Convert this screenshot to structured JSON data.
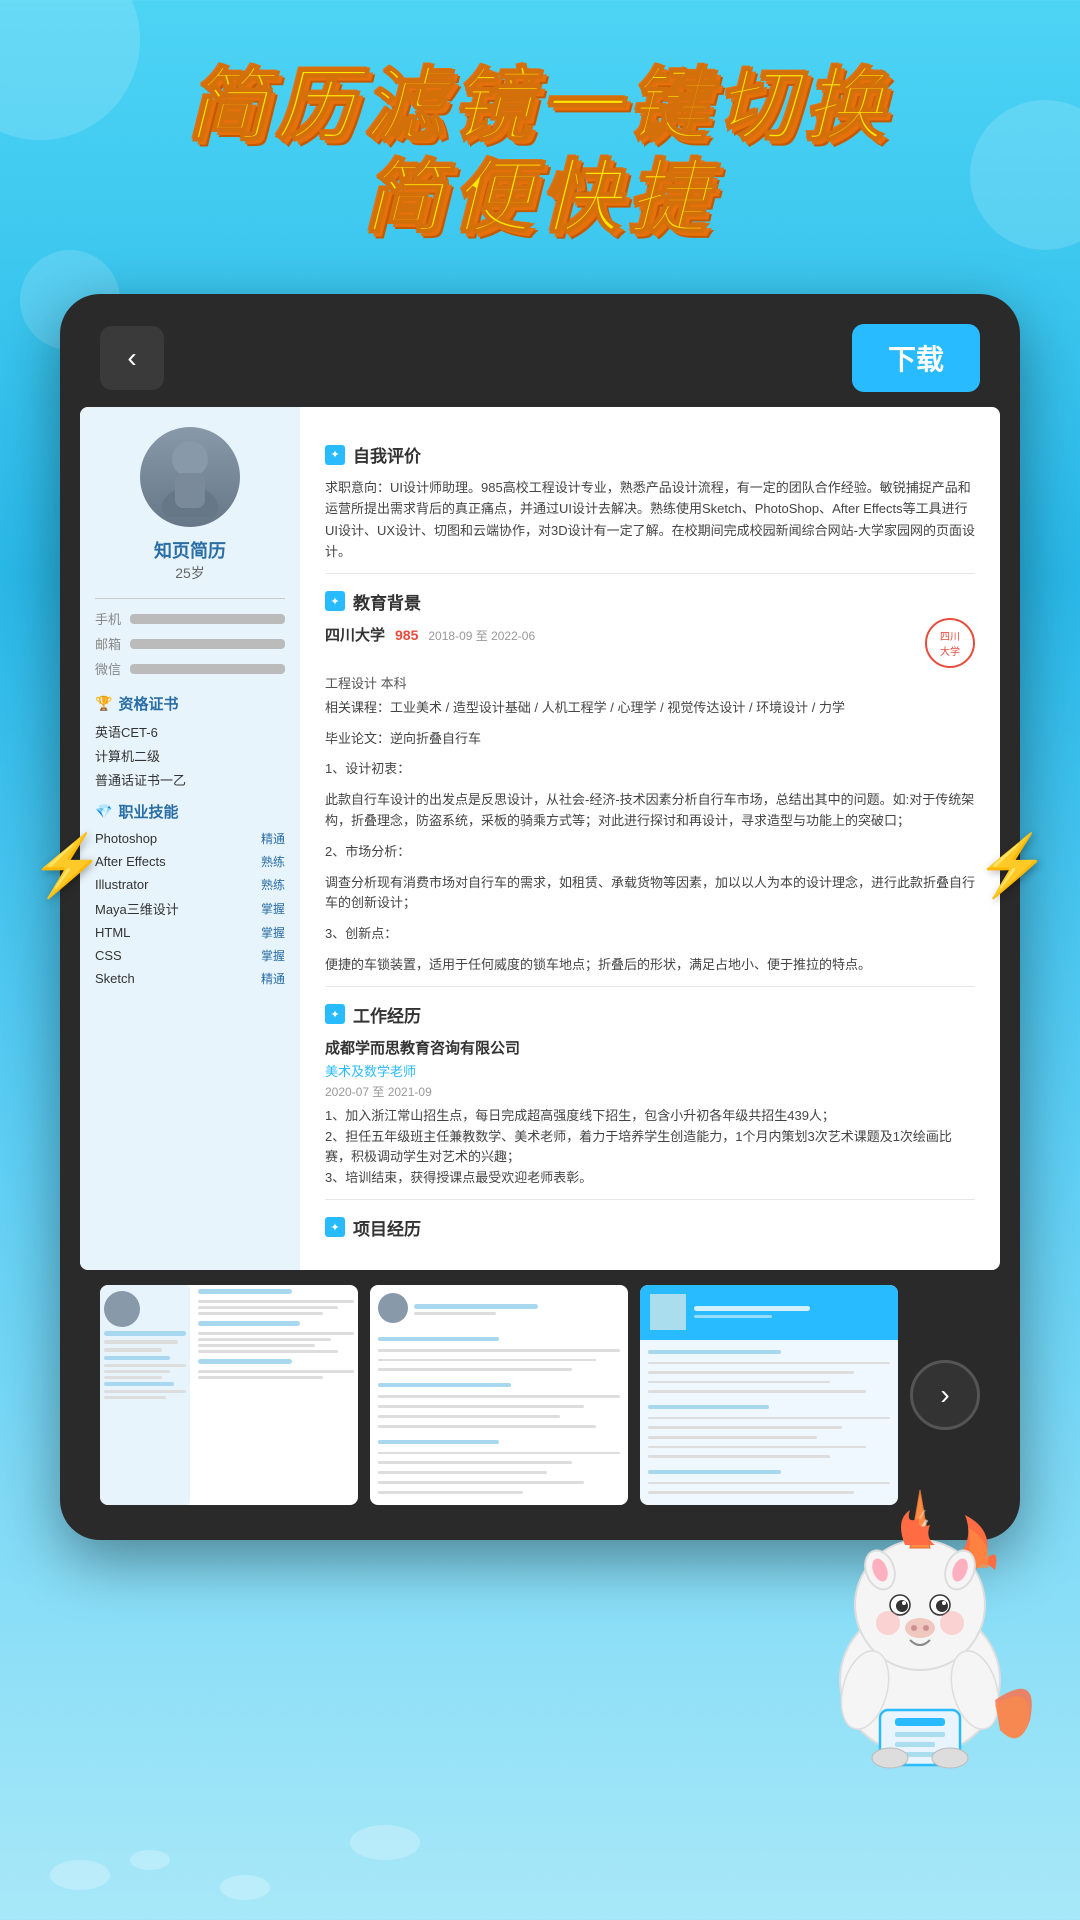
{
  "page": {
    "background_color": "#4dd4f5",
    "title_line1": "简历滤镜一键切换",
    "title_line2": "简便快捷"
  },
  "device": {
    "back_button_label": "‹",
    "download_button_label": "下载"
  },
  "resume": {
    "person": {
      "brand": "知页简历",
      "age": "25岁",
      "avatar_alt": "person avatar"
    },
    "contact": {
      "phone_label": "手机",
      "email_label": "邮箱",
      "wechat_label": "微信"
    },
    "certificates_title": "资格证书",
    "certificates": [
      "英语CET-6",
      "计算机二级",
      "普通话证书一乙"
    ],
    "skills_title": "职业技能",
    "skills": [
      {
        "name": "Photoshop",
        "level": "精通"
      },
      {
        "name": "After Effects",
        "level": "熟练"
      },
      {
        "name": "Illustrator",
        "level": "熟练"
      },
      {
        "name": "Maya三维设计",
        "level": "掌握"
      },
      {
        "name": "HTML",
        "level": "掌握"
      },
      {
        "name": "CSS",
        "level": "掌握"
      },
      {
        "name": "Sketch",
        "level": "精通"
      }
    ],
    "self_eval_title": "自我评价",
    "self_eval_text": "求职意向：UI设计师助理。985高校工程设计专业，熟悉产品设计流程，有一定的团队合作经验。敏锐捕捉产品和运营所提出需求背后的真正痛点，并通过UI设计去解决。熟练使用Sketch、PhotoShop、After Effects等工具进行UI设计、UX设计、切图和云端协作，对3D设计有一定了解。在校期间完成校园新闻综合网站-大学家园网的页面设计。",
    "education_title": "教育背景",
    "education": {
      "school": "四川大学",
      "score": "985",
      "date_range": "2018-09 至 2022-06",
      "degree": "工程设计  本科",
      "courses": "相关课程：工业美术 / 造型设计基础 / 人机工程学 / 心理学 / 视觉传达设计 / 环境设计 / 力学",
      "thesis": "毕业论文：逆向折叠自行车",
      "thesis_point1": "1、设计初衷：",
      "thesis_desc1": "此款自行车设计的出发点是反思设计，从社会-经济-技术因素分析自行车市场，总结出其中的问题。如:对于传统架构，折叠理念，防盗系统，采板的骑乘方式等；对此进行探讨和再设计，寻求造型与功能上的突破口；",
      "thesis_point2": "2、市场分析：",
      "thesis_desc2": "调查分析现有消费市场对自行车的需求，如租赁、承载货物等因素，加以以人为本的设计理念，进行此款折叠自行车的创新设计；",
      "thesis_point3": "3、创新点：",
      "thesis_desc3": "便捷的车锁装置，适用于任何威度的锁车地点；折叠后的形状，满足占地小、便于推拉的特点。"
    },
    "work_title": "工作经历",
    "work": {
      "company": "成都学而思教育咨询有限公司",
      "position": "美术及数学老师",
      "date_range": "2020-07 至 2021-09",
      "point1": "1、加入浙江常山招生点，每日完成超高强度线下招生，包含小升初各年级共招生439人；",
      "point2": "2、担任五年级班主任兼教数学、美术老师，着力于培养学生创造能力，1个月内策划3次艺术课题及1次绘画比赛，积极调动学生对艺术的兴趣；",
      "point3": "3、培训结束，获得授课点最受欢迎老师表彰。"
    },
    "project_title": "项目经历"
  },
  "thumbnails": [
    {
      "id": 1,
      "type": "sidebar_layout"
    },
    {
      "id": 2,
      "type": "centered_layout"
    },
    {
      "id": 3,
      "type": "photo_layout"
    }
  ],
  "icons": {
    "back": "‹",
    "next": "›",
    "star": "★",
    "bolt": "⚡"
  }
}
